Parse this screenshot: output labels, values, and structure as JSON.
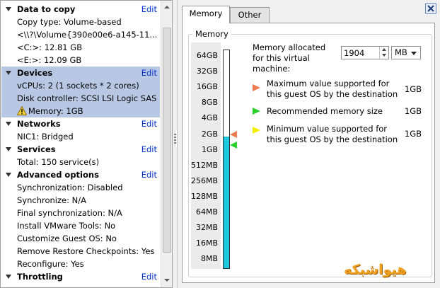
{
  "left_panel": {
    "sections": [
      {
        "title": "Data to copy",
        "edit": "Edit",
        "rows": [
          "Copy type: Volume-based",
          "<\\\\?\\Volume{390e00e6-a145-11...",
          "<C:>: 12.81 GB",
          "<E:>: 12.09 GB"
        ]
      },
      {
        "title": "Devices",
        "edit": "Edit",
        "rows": [
          "vCPUs: 2 (1 sockets * 2 cores)",
          "Disk controller: SCSI LSI Logic SAS",
          "Memory: 1GB"
        ]
      },
      {
        "title": "Networks",
        "edit": "Edit",
        "rows": [
          "NIC1: Bridged"
        ]
      },
      {
        "title": "Services",
        "edit": "Edit",
        "rows": [
          "Total: 150 service(s)"
        ]
      },
      {
        "title": "Advanced options",
        "edit": "Edit",
        "rows": [
          "Synchronization: Disabled",
          "Synchronize: N/A",
          "Final synchronization: N/A",
          "Install VMware Tools: No",
          "Customize Guest OS: No",
          "Remove Restore Checkpoints: Yes",
          "Reconfigure: Yes"
        ]
      },
      {
        "title": "Throttling",
        "edit": "Edit",
        "rows": []
      }
    ],
    "warning_icon": "warning-triangle-icon",
    "selected_section": "Devices"
  },
  "tabs": [
    "Memory",
    "Other"
  ],
  "memory": {
    "group_title": "Memory",
    "scale_labels": [
      "64GB",
      "32GB",
      "16GB",
      "8GB",
      "4GB",
      "2GB",
      "1GB",
      "512MB",
      "256MB",
      "128MB",
      "64MB",
      "32MB",
      "16MB",
      "8MB"
    ],
    "allocated_label": "Memory allocated for this virtual machine:",
    "allocated_value": "1904",
    "unit": "MB",
    "legend": [
      {
        "color": "#ee7a50",
        "text": "Maximum value supported for this guest OS by the destination",
        "value": "1GB"
      },
      {
        "color": "#2ad12a",
        "text": "Recommended memory size",
        "value": "1GB"
      },
      {
        "color": "#f4f000",
        "text": "Minimum value supported for this guest OS by the destination",
        "value": "1GB"
      }
    ]
  },
  "watermark": "هیواشبکه",
  "colors": {
    "bar_fill": "#1ec8dc",
    "selection": "#b8c8e4",
    "link": "#0033cc"
  }
}
